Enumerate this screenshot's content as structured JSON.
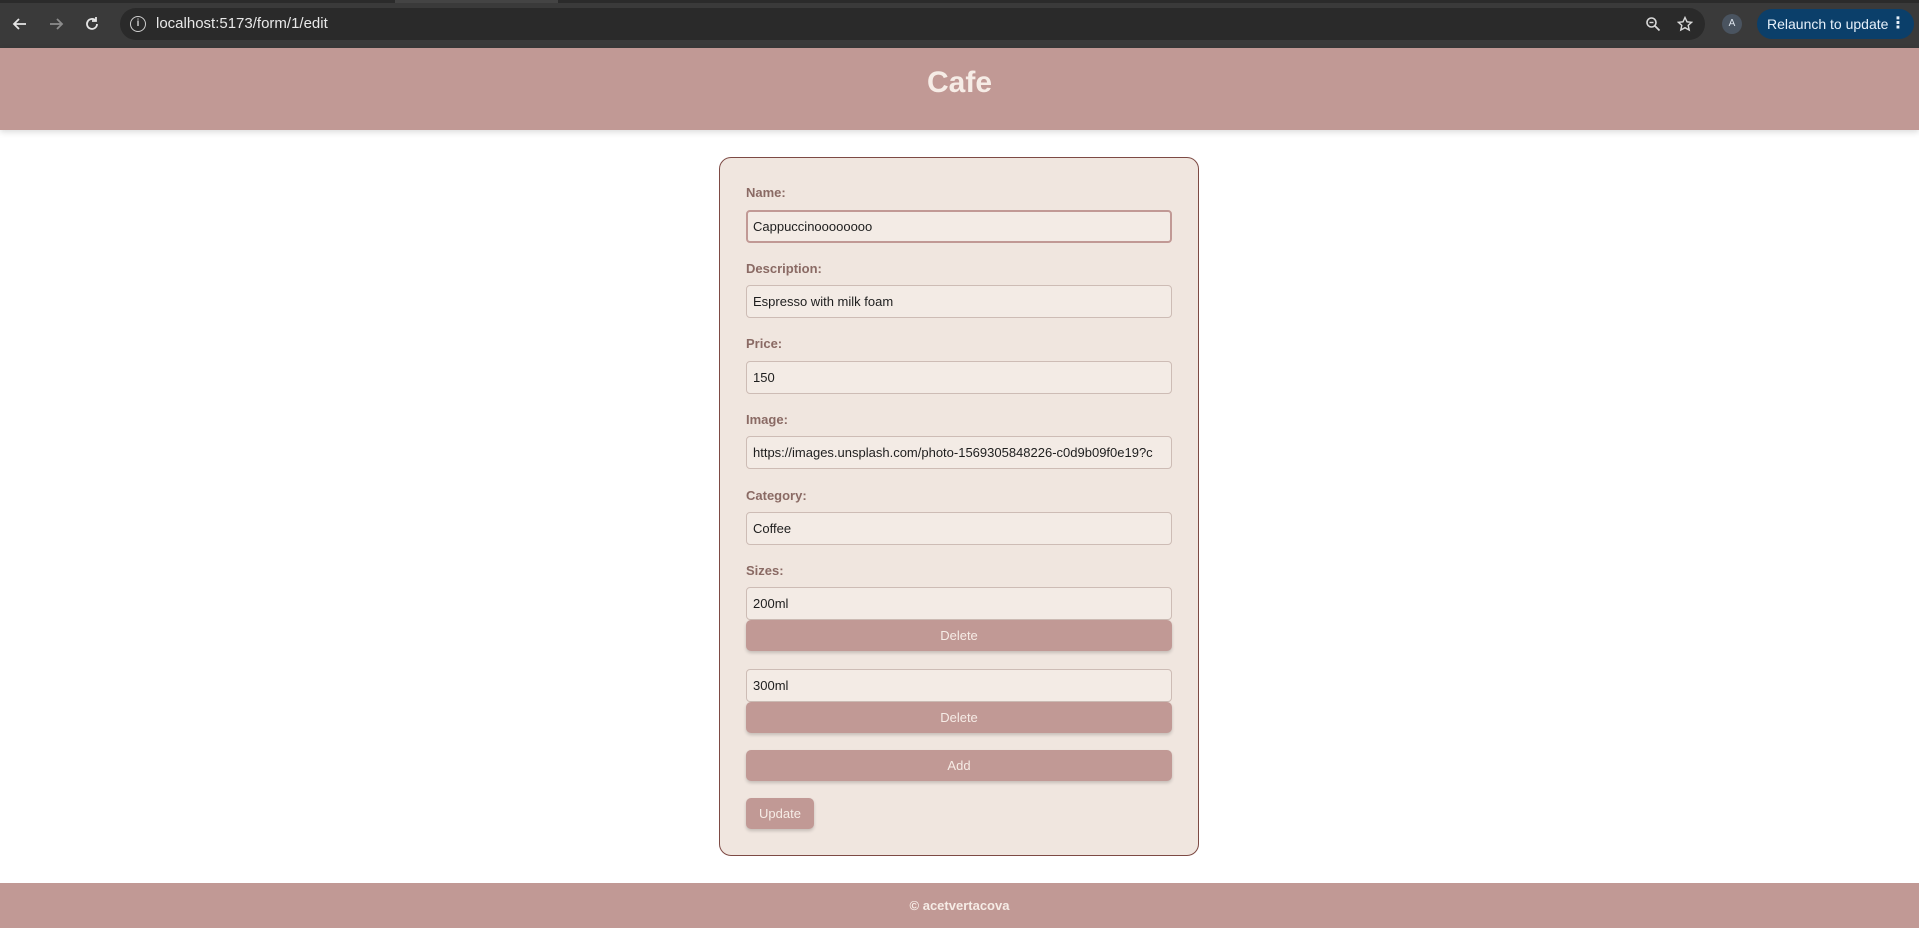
{
  "browser": {
    "url": "localhost:5173/form/1/edit",
    "profile_initial": "A",
    "relaunch_label": "Relaunch to update"
  },
  "site": {
    "title": "Cafe",
    "footer": "© acetvertacova"
  },
  "form": {
    "name_label": "Name:",
    "name_value": "Cappuccinoooooooo",
    "description_label": "Description:",
    "description_value": "Espresso with milk foam",
    "price_label": "Price:",
    "price_value": "150",
    "image_label": "Image:",
    "image_value": "https://images.unsplash.com/photo-1569305848226-c0d9b09f0e19?c",
    "category_label": "Category:",
    "category_value": "Coffee",
    "sizes_label": "Sizes:",
    "sizes": [
      {
        "value": "200ml",
        "delete_label": "Delete"
      },
      {
        "value": "300ml",
        "delete_label": "Delete"
      }
    ],
    "add_label": "Add",
    "update_label": "Update"
  },
  "colors": {
    "brand": "#c19995",
    "card_background": "#f0e6df",
    "card_border": "#7d4a44",
    "relaunch_button": "#0b3f6a"
  }
}
